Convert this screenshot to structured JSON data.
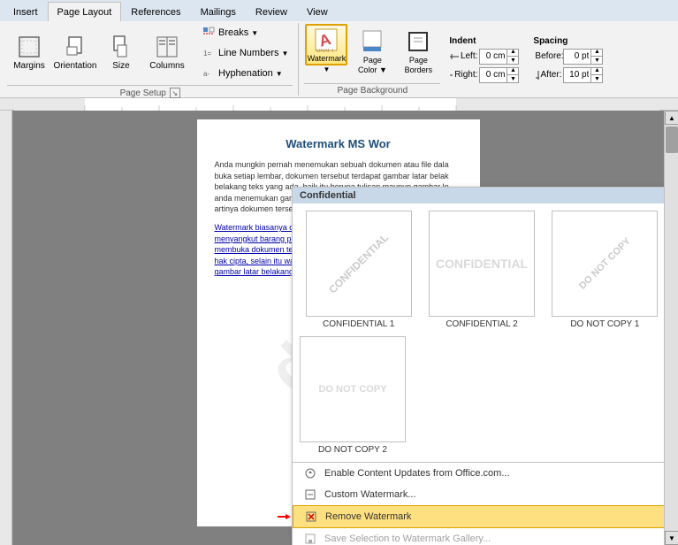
{
  "tabs": [
    {
      "label": "Insert",
      "active": false
    },
    {
      "label": "Page Layout",
      "active": true
    },
    {
      "label": "References",
      "active": false
    },
    {
      "label": "Mailings",
      "active": false
    },
    {
      "label": "Review",
      "active": false
    },
    {
      "label": "View",
      "active": false
    }
  ],
  "ribbon": {
    "groups": {
      "margins": {
        "label": "Margins",
        "icon": "margins"
      },
      "orientation": {
        "label": "Orientation",
        "icon": "orientation"
      },
      "size": {
        "label": "Size",
        "icon": "size"
      },
      "columns": {
        "label": "Columns",
        "icon": "columns"
      },
      "breaks": {
        "label": "Breaks"
      },
      "line_numbers": {
        "label": "Line Numbers"
      },
      "hyphenation": {
        "label": "Hyphenation"
      },
      "page_setup_label": "Page Setup",
      "watermark": {
        "label": "Watermark",
        "active": true
      },
      "page_color": {
        "label": "Page\nColor"
      },
      "page_borders": {
        "label": "Page\nBorders"
      },
      "indent_label": "Indent",
      "left_label": "Left:",
      "left_val": "0 cm",
      "right_label": "Right:",
      "right_val": "0 cm",
      "spacing_label": "Spacing",
      "before_label": "Before:",
      "before_val": "0 pt",
      "after_label": "After:",
      "after_val": "10 pt"
    }
  },
  "watermark_panel": {
    "header": "Confidential",
    "items": [
      {
        "label": "CONFIDENTIAL 1",
        "text": "CONFIDENTIAL",
        "style": "diagonal"
      },
      {
        "label": "CONFIDENTIAL 2",
        "text": "CONFIDENTIAL",
        "style": "light"
      },
      {
        "label": "DO NOT COPY 1",
        "text": "DO NOT COPY",
        "style": "diagonal"
      },
      {
        "label": "DO NOT COPY 2",
        "text": "DO NOT COPY",
        "style": "light"
      }
    ],
    "menu": [
      {
        "label": "Enable Content Updates from Office.com...",
        "icon": "cloud",
        "disabled": false,
        "highlighted": false
      },
      {
        "label": "Custom Watermark...",
        "icon": "custom",
        "disabled": false,
        "highlighted": false
      },
      {
        "label": "Remove Watermark",
        "icon": "remove",
        "disabled": false,
        "highlighted": true
      },
      {
        "label": "Save Selection to Watermark Gallery...",
        "icon": "save",
        "disabled": true,
        "highlighted": false
      }
    ]
  },
  "document": {
    "title": "Watermark MS Wor",
    "paragraphs": [
      "Anda mungkin pernah menemukan sebuah dokumen atau file dala buka setiap lembar, dokumen tersebut terdapat gambar latar belak belakang teks yang ada, baik itu berupa tulisan maupun gambar lo anda menemukan gambar transparan semacam itu baik itu berupa itu artinya dokumen tersebut sudah di beri watermark oleh si pem",
      "Watermark biasanya dibuat untuk memberikan penekanan terhad menyangkut barang perusahaan, nama perusahaan atau hak cipta, membuka dokumen tersebut tau sumber dokumen tersebut atau 1 hak cipta, selain itu watermark terkadang digunakan untuk hal-hal gambar latar belakang."
    ],
    "watermark_text": "diseo"
  }
}
